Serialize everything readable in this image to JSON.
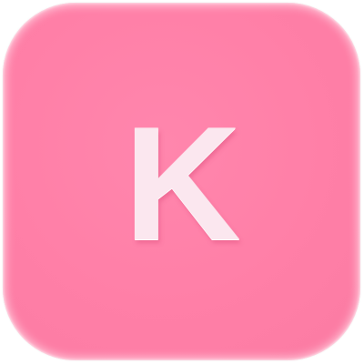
{
  "app_icon": {
    "letter": "K",
    "background_color": "#ff7fa7",
    "letter_color": "#fbe7ef"
  }
}
